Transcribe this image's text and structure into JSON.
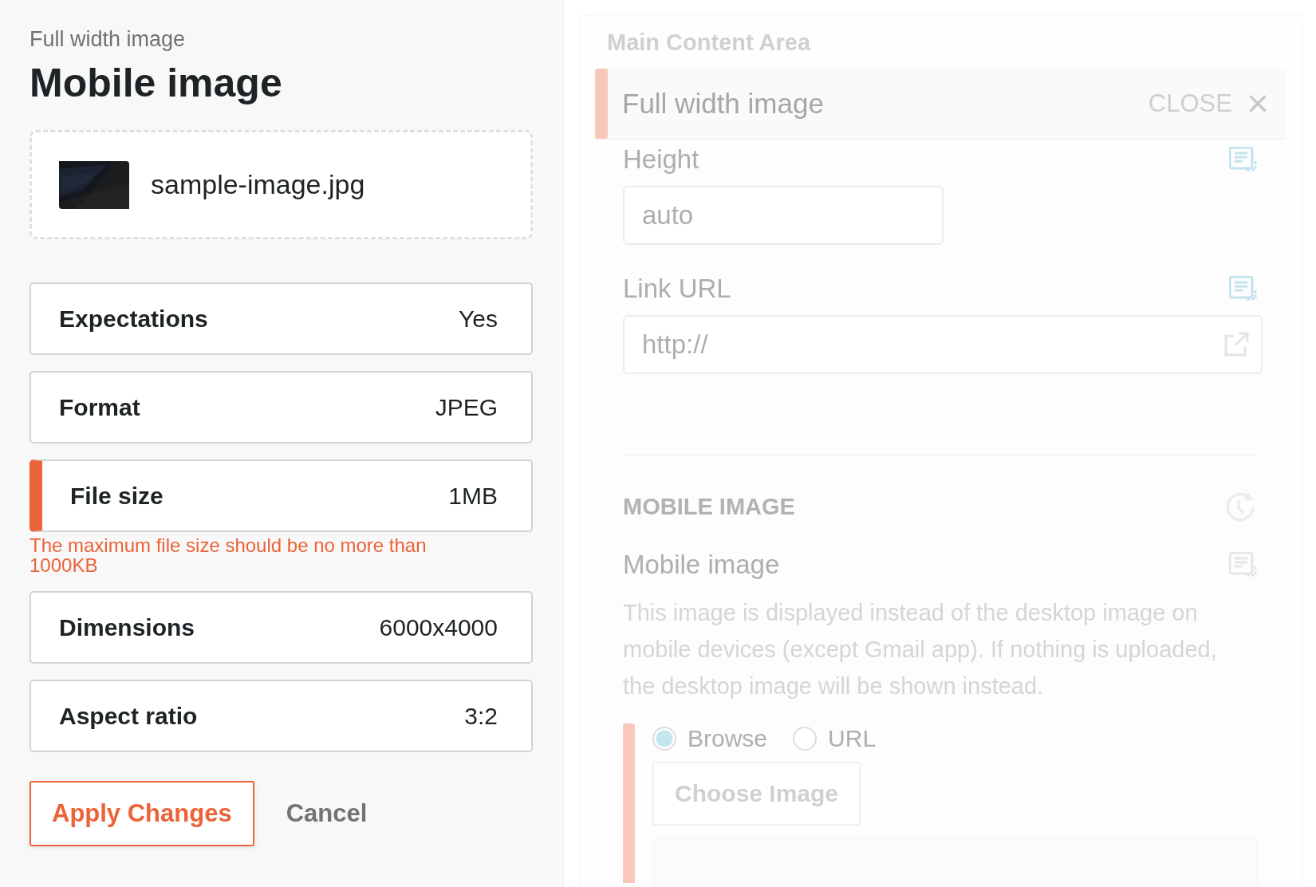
{
  "editor": {
    "subtitle": "Full width image",
    "title": "Mobile image",
    "file": {
      "kind": "picture",
      "name": "sample-image.jpg"
    },
    "checks": [
      {
        "label": "Expectations",
        "value": "Yes",
        "error": false
      },
      {
        "label": "Format",
        "value": "JPEG",
        "error": false
      },
      {
        "label": "File size",
        "value": "1MB",
        "error": true,
        "message": "The maximum file size should be no more than 1000KB"
      },
      {
        "label": "Dimensions",
        "value": "6000x4000",
        "error": false
      },
      {
        "label": "Aspect ratio",
        "value": "3:2",
        "error": false
      }
    ],
    "buttons": {
      "apply": "Apply Changes",
      "cancel": "Cancel"
    }
  },
  "content": {
    "title": "Main Content Area",
    "block": {
      "title": "Full width image",
      "close": "CLOSE",
      "close_icon": "×"
    },
    "fields": [
      {
        "label": "Height",
        "value": "auto",
        "synced": true,
        "wide": false
      },
      {
        "label": "Link URL",
        "value": "http://",
        "synced": true,
        "wide": true
      }
    ],
    "section": {
      "title": "MOBILE IMAGE",
      "field": {
        "label": "Mobile image",
        "synced": false,
        "help": "This image is displayed instead of the desktop image on mobile devices (except Gmail app). If nothing is uploaded, the desktop image will be shown instead."
      },
      "sources": [
        {
          "label": "Browse",
          "selected": true
        },
        {
          "label": "URL",
          "selected": false
        }
      ],
      "choose": "Choose Image"
    }
  }
}
